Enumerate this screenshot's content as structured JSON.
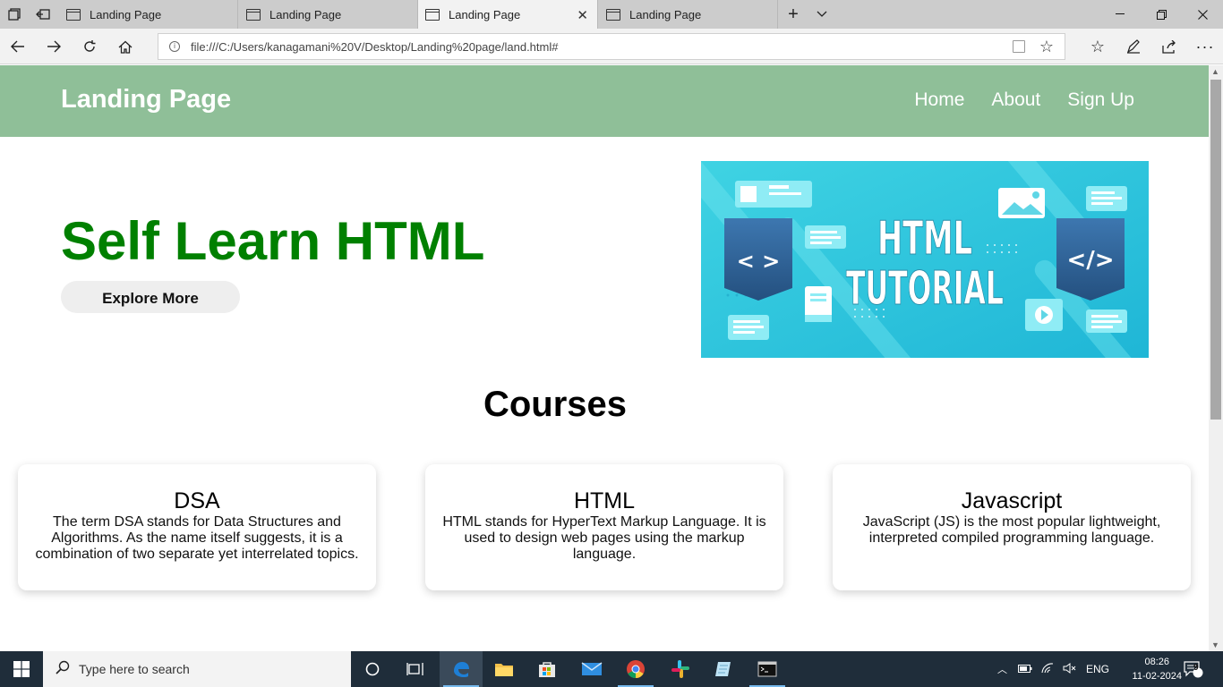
{
  "browser": {
    "tabs": [
      {
        "label": "Landing Page",
        "active": false
      },
      {
        "label": "Landing Page",
        "active": false
      },
      {
        "label": "Landing Page",
        "active": true
      },
      {
        "label": "Landing Page",
        "active": false
      }
    ],
    "url": "file:///C:/Users/kanagamani%20V/Desktop/Landing%20page/land.html#"
  },
  "site": {
    "title": "Landing Page",
    "nav": [
      "Home",
      "About",
      "Sign Up"
    ],
    "header_color": "#8fbf98"
  },
  "hero": {
    "heading": "Self Learn HTML",
    "heading_color": "#008000",
    "button_label": "Explore More",
    "image": {
      "line1": "HTML",
      "line2": "TUTORIAL",
      "left_badge": "< >",
      "right_badge": "</>"
    }
  },
  "courses": {
    "title": "Courses",
    "items": [
      {
        "name": "DSA",
        "description": "The term DSA stands for Data Structures and Algorithms. As the name itself suggests, it is a combination of two separate yet interrelated topics."
      },
      {
        "name": "HTML",
        "description": "HTML stands for HyperText Markup Language. It is used to design web pages using the markup language."
      },
      {
        "name": "Javascript",
        "description": "JavaScript (JS) is the most popular lightweight, interpreted compiled programming language."
      }
    ]
  },
  "taskbar": {
    "search_placeholder": "Type here to search",
    "language": "ENG",
    "time": "08:26",
    "date": "11-02-2024",
    "notifications": "9"
  }
}
